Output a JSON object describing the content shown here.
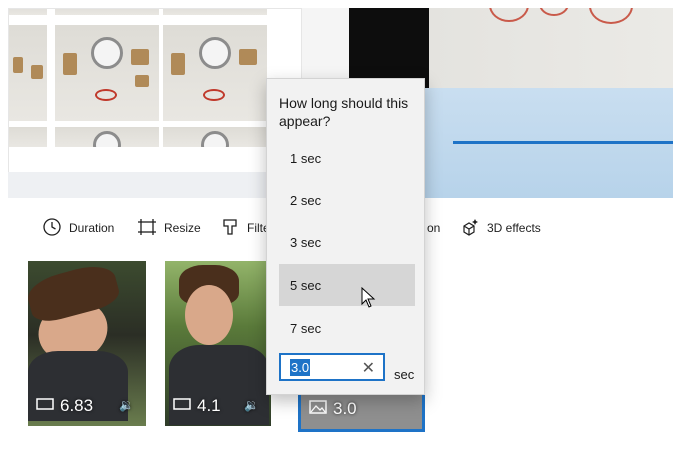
{
  "toolbar": {
    "duration_label": "Duration",
    "resize_label": "Resize",
    "filters_label": "Filte",
    "hidden_tail": "on",
    "effects_label": "3D effects"
  },
  "storyboard": {
    "clips": [
      {
        "duration": "6.83",
        "has_audio": true
      },
      {
        "duration": "4.1",
        "has_audio": true
      },
      {
        "duration": "3.0",
        "has_audio": false,
        "selected": true
      }
    ]
  },
  "flyout": {
    "title": "How long should this appear?",
    "options": [
      "1 sec",
      "2 sec",
      "3 sec",
      "5 sec",
      "7 sec"
    ],
    "hovered_option": "5 sec",
    "custom_value": "3.0",
    "unit": "sec"
  },
  "icons": {
    "duration": "clock-icon",
    "resize": "resize-icon",
    "filters": "filters-icon",
    "effects": "3d-effects-icon",
    "video": "video-clip-icon",
    "image": "image-clip-icon",
    "audio": "speaker-icon",
    "clear": "close-icon"
  },
  "colors": {
    "accent": "#1e73c7",
    "flyout_bg": "#f2f2f2",
    "hover_bg": "#d6d6d6"
  }
}
